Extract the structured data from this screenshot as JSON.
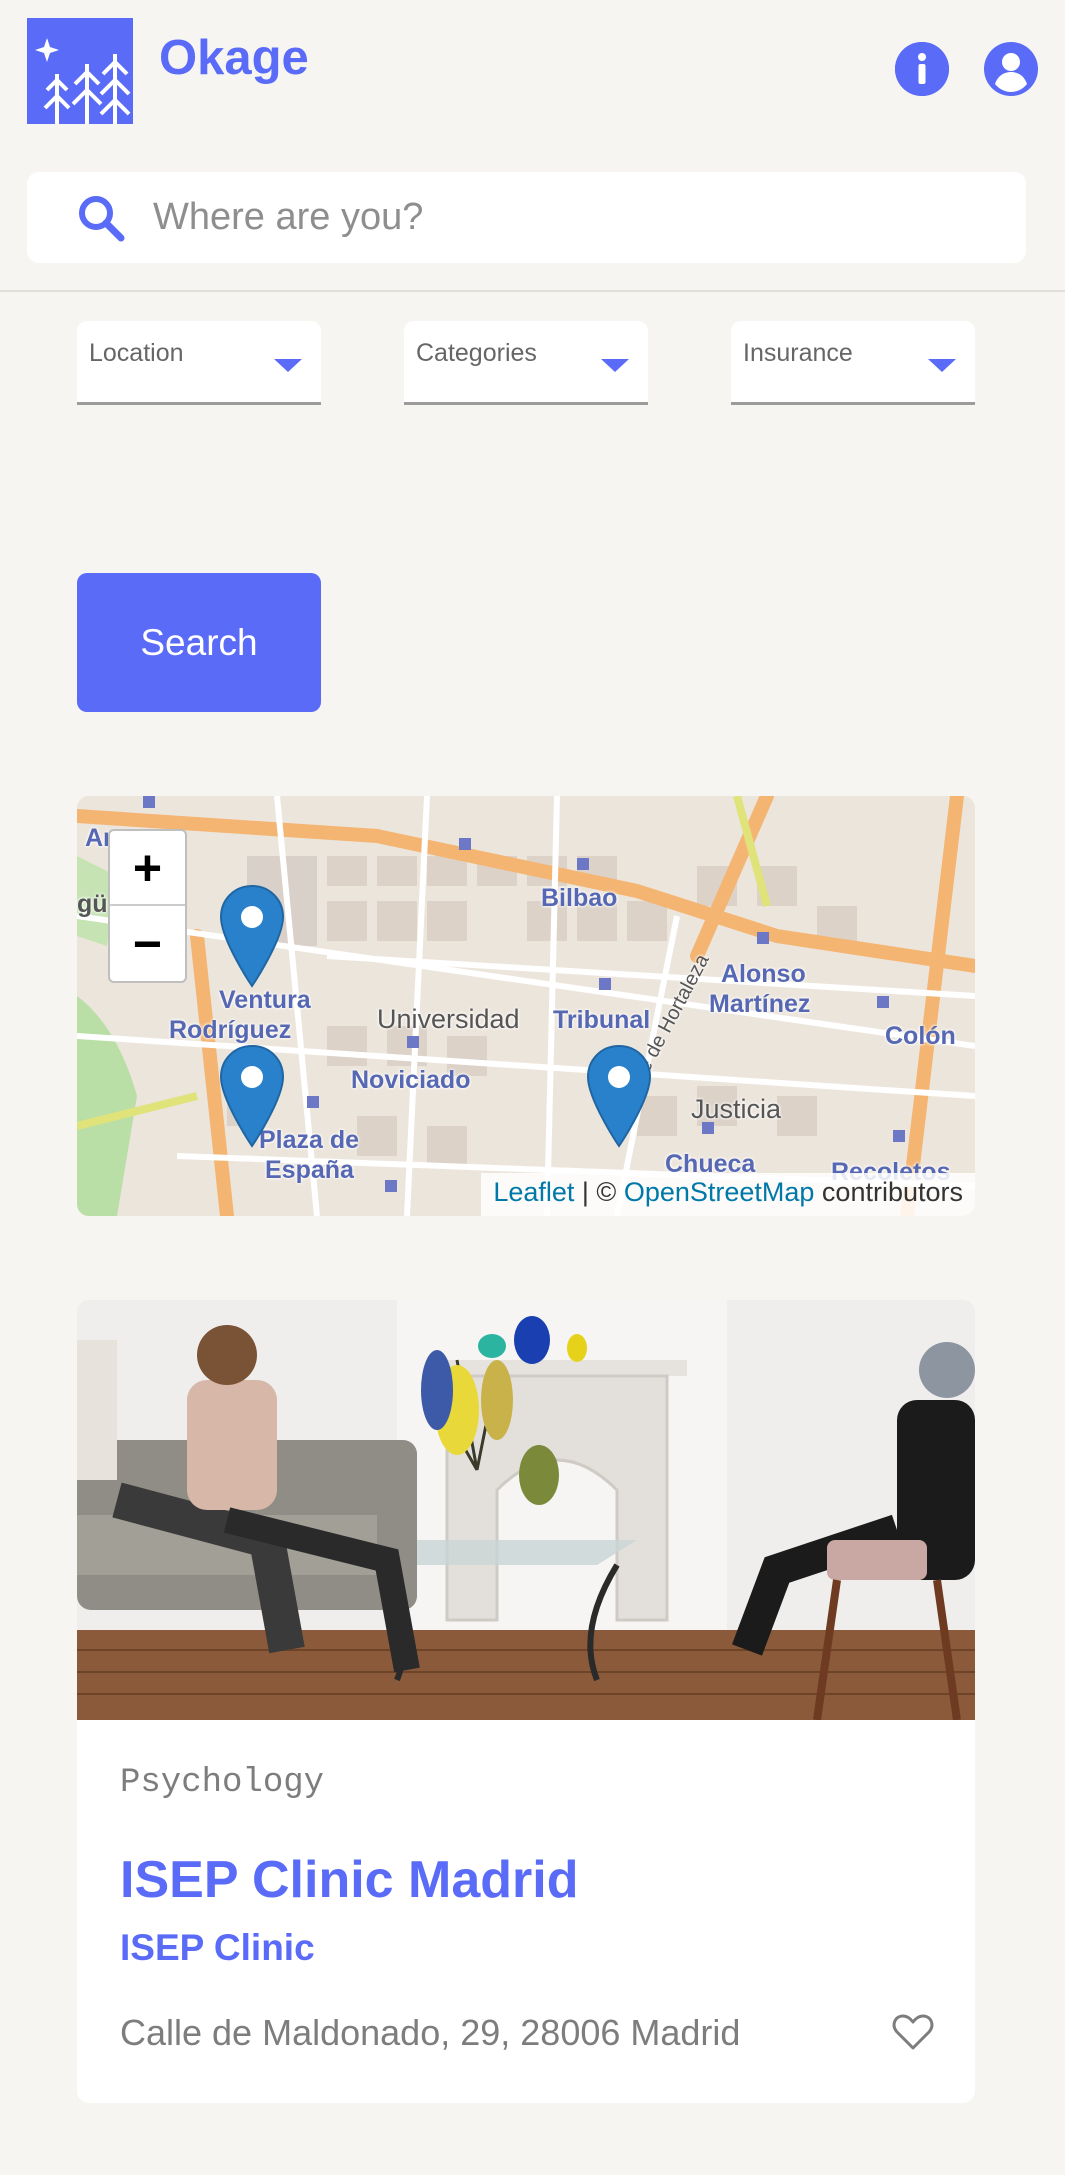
{
  "header": {
    "brand": "Okage",
    "logo_icon": "forest-stars-icon",
    "info_icon": "info-icon",
    "user_icon": "account-icon"
  },
  "search": {
    "placeholder": "Where are you?",
    "value": "",
    "icon": "search-icon"
  },
  "filters": [
    {
      "label": "Location",
      "icon": "caret-down-icon"
    },
    {
      "label": "Categories",
      "icon": "caret-down-icon"
    },
    {
      "label": "Insurance",
      "icon": "caret-down-icon"
    }
  ],
  "search_button": {
    "label": "Search"
  },
  "map": {
    "zoom_in": "+",
    "zoom_out": "−",
    "attribution": {
      "leaflet": "Leaflet",
      "separator": " | © ",
      "osm": "OpenStreetMap",
      "suffix": " contributors"
    },
    "labels": [
      {
        "text": "Bilbao"
      },
      {
        "text": "Ventura"
      },
      {
        "text": "Rodríguez"
      },
      {
        "text": "Universidad"
      },
      {
        "text": "Tribunal"
      },
      {
        "text": "Alonso"
      },
      {
        "text": "Martínez"
      },
      {
        "text": "Colón"
      },
      {
        "text": "Noviciado"
      },
      {
        "text": "Justicia"
      },
      {
        "text": "Plaza de"
      },
      {
        "text": "España"
      },
      {
        "text": "Chueca"
      },
      {
        "text": "Recoletos"
      },
      {
        "text": "Calle de Hortaleza"
      }
    ],
    "marker_count": 3
  },
  "card": {
    "category": "Psychology",
    "name": "ISEP Clinic Madrid",
    "organization": "ISEP Clinic",
    "address": "Calle de Maldonado, 29, 28006 Madrid",
    "favorite_icon": "heart-outline-icon"
  },
  "colors": {
    "accent": "#5a6bf8",
    "background": "#f7f5f2",
    "marker": "#2a81cb"
  }
}
